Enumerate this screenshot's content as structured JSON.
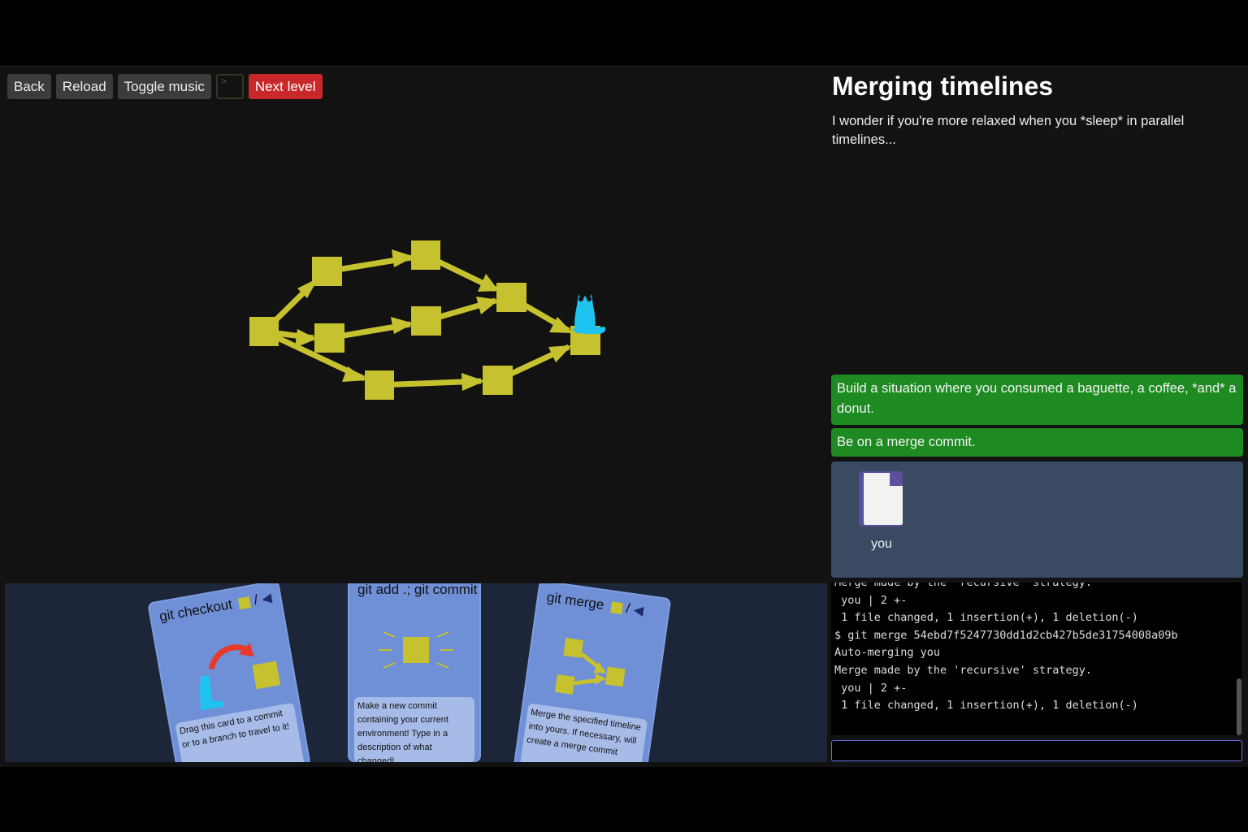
{
  "toolbar": {
    "back": "Back",
    "reload": "Reload",
    "toggle_music": "Toggle music",
    "terminal_glyph": ">",
    "next_level": "Next level"
  },
  "level": {
    "title": "Merging timelines",
    "description": "I wonder if you're more relaxed when you *sleep* in parallel timelines..."
  },
  "goals": [
    "Build a situation where you consumed a baguette, a coffee, *and* a donut.",
    "Be on a merge commit."
  ],
  "files": [
    {
      "name": "you",
      "icon": "file-icon"
    }
  ],
  "terminal": {
    "lines": [
      "Merge made by the 'recursive' strategy.",
      " you | 2 +-",
      " 1 file changed, 1 insertion(+), 1 deletion(-)",
      "$ git merge 54ebd7f5247730dd1d2cb427b5de31754008a09b",
      "Auto-merging you",
      "Merge made by the 'recursive' strategy.",
      " you | 2 +-",
      " 1 file changed, 1 insertion(+), 1 deletion(-)"
    ],
    "input_value": ""
  },
  "cards": [
    {
      "title": "git checkout",
      "separator": "/",
      "description": "Drag this card to a commit or to a branch to travel to it!",
      "art": "checkout-art"
    },
    {
      "title": "git add .; git commit",
      "description": "Make a new commit containing your current environment! Type in a description of what changed!",
      "art": "commit-art"
    },
    {
      "title": "git merge",
      "separator": "/",
      "description": "Merge the specified timeline into yours. If necessary, will create a merge commit",
      "art": "merge-art"
    }
  ],
  "colors": {
    "commit": "#c6c12e",
    "goal_bg": "#1e8a22",
    "card_bg": "#6f8fd6",
    "head": "#1ec3f0",
    "next_level": "#c8282a"
  }
}
